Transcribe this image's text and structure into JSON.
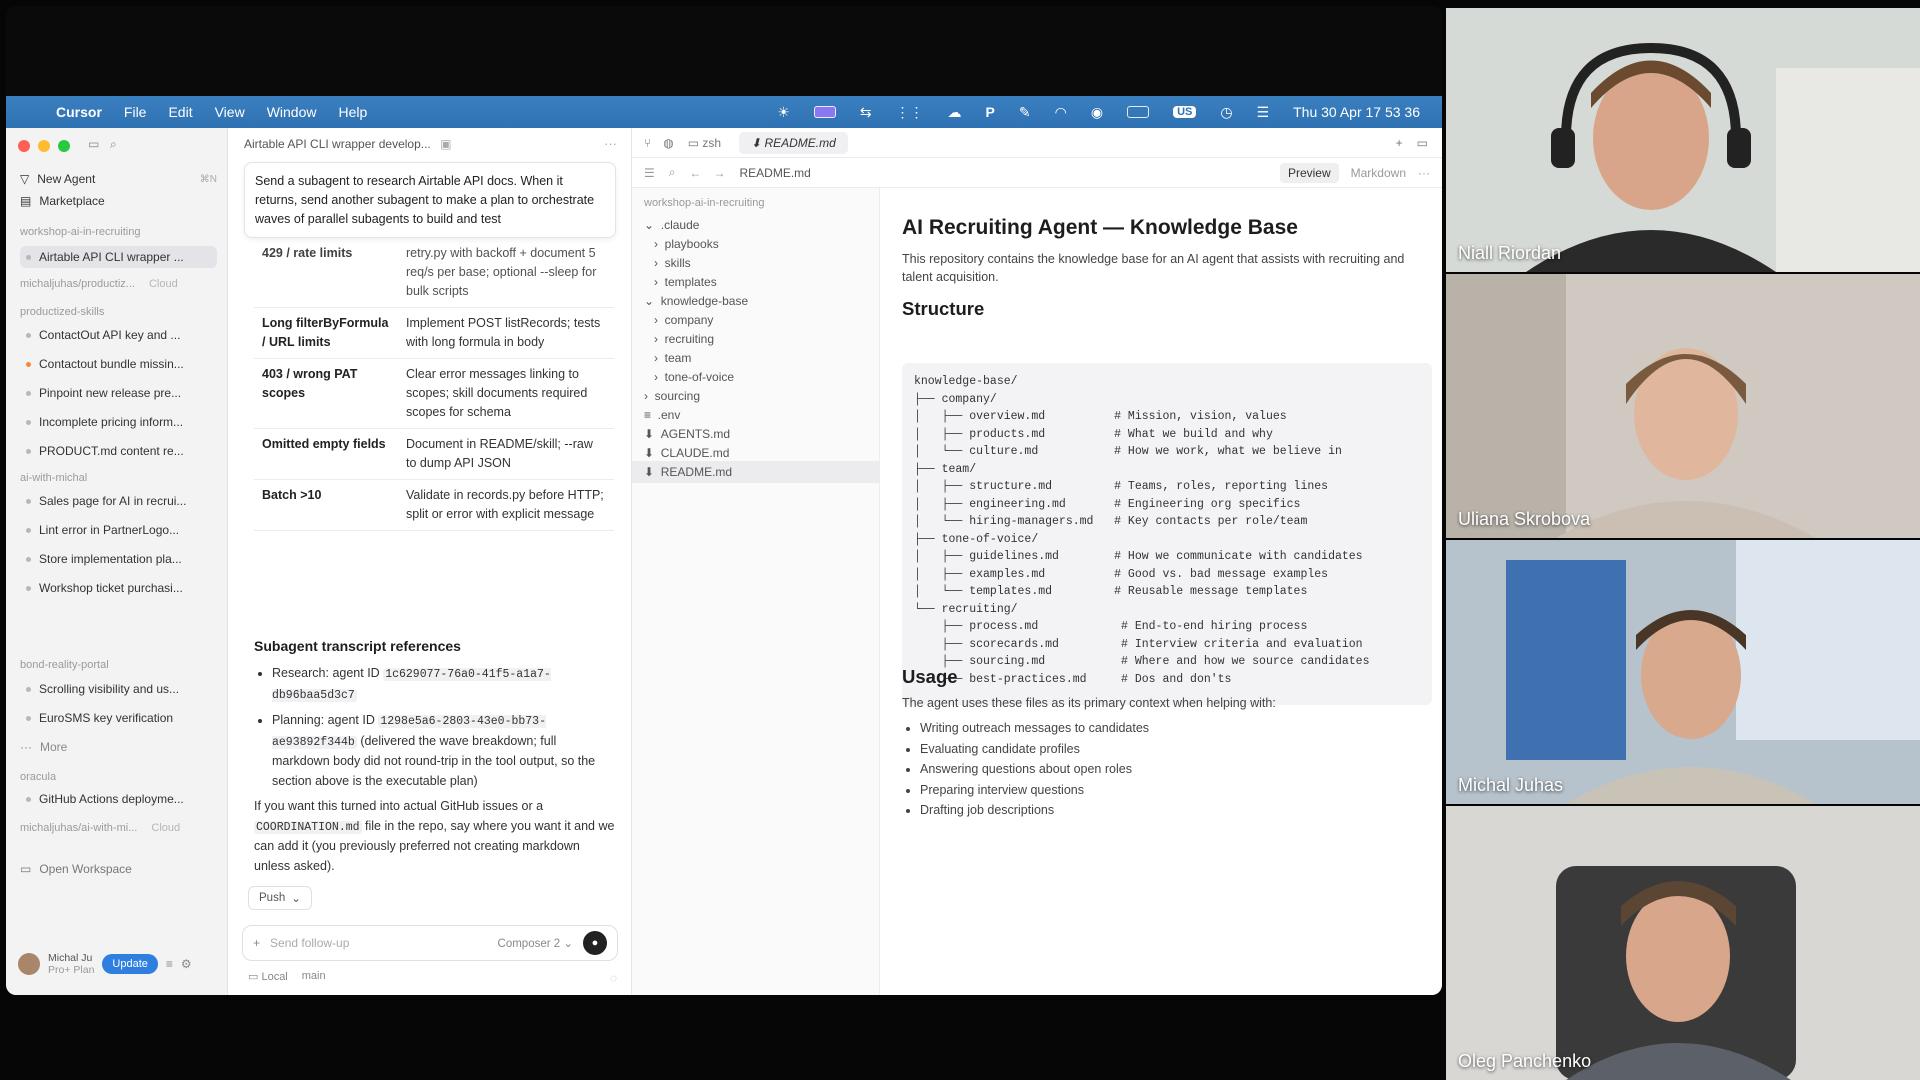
{
  "menubar": {
    "app_name": "Cursor",
    "menus": [
      "File",
      "Edit",
      "View",
      "Window",
      "Help"
    ],
    "clock": "Thu 30 Apr  17 53 36",
    "input_badge": "US"
  },
  "sidebar": {
    "new_agent": "New Agent",
    "new_agent_shortcut": "⌘N",
    "marketplace": "Marketplace",
    "groups": [
      {
        "label": "workshop-ai-in-recruiting",
        "tag": "",
        "items": [
          "Airtable API CLI wrapper ..."
        ]
      },
      {
        "label": "michaljuhas/productiz...",
        "tag": "Cloud",
        "items": []
      },
      {
        "label": "productized-skills",
        "tag": "",
        "items": [
          "ContactOut API key and ...",
          "Contactout bundle missin...",
          "Pinpoint new release pre...",
          "Incomplete pricing inform...",
          "PRODUCT.md content re..."
        ]
      },
      {
        "label": "ai-with-michal",
        "tag": "",
        "items": [
          "Sales page for AI in recrui...",
          "Lint error in PartnerLogo...",
          "Store implementation pla...",
          "Workshop ticket purchasi..."
        ]
      },
      {
        "label": "bond-reality-portal",
        "tag": "",
        "items": [
          "Scrolling visibility and us...",
          "EuroSMS key verification"
        ]
      },
      {
        "label": "oracula",
        "tag": "",
        "items": [
          "GitHub Actions deployme..."
        ]
      },
      {
        "label": "michaljuhas/ai-with-mi...",
        "tag": "Cloud",
        "items": []
      }
    ],
    "more": "More",
    "open_workspace": "Open Workspace",
    "user_name": "Michal Ju",
    "user_plan": "Pro+ Plan",
    "update_button": "Update"
  },
  "chat": {
    "title": "Airtable API CLI wrapper develop...",
    "prompt": "Send a subagent to research Airtable API docs. When it returns, send another subagent to make a plan to orchestrate waves of parallel subagents to build and test",
    "table_top_fragment": {
      "left": "429 / rate limits",
      "right": "retry.py with backoff + document 5 req/s per base; optional --sleep for bulk scripts"
    },
    "table": [
      {
        "left": "Long filterByFormula / URL limits",
        "right": "Implement POST listRecords; tests with long formula in body"
      },
      {
        "left": "403 / wrong PAT scopes",
        "right": "Clear error messages linking to scopes; skill documents required scopes for schema"
      },
      {
        "left": "Omitted empty fields",
        "right": "Document in README/skill; --raw to dump API JSON"
      },
      {
        "left": "Batch >10",
        "right": "Validate in records.py before HTTP; split or error with explicit message"
      }
    ],
    "refs_heading": "Subagent transcript references",
    "ref1_label": "Research: agent ID",
    "ref1_id": "1c629077-76a0-41f5-a1a7-db96baa5d3c7",
    "ref2_label": "Planning: agent ID",
    "ref2_id": "1298e5a6-2803-43e0-bb73-ae93892f344b",
    "ref2_note": "(delivered the wave breakdown; full markdown body did not round-trip in the tool output, so the section above is the executable plan)",
    "closing_pre": "If you want this turned into actual GitHub issues or a",
    "closing_code": "COORDINATION.md",
    "closing_post": "file in the repo, say where you want it and we can add it (you previously preferred not creating markdown unless asked).",
    "push_label": "Push",
    "followup_placeholder": "Send follow-up",
    "model_label": "Composer 2",
    "footer_local": "Local",
    "footer_branch": "main"
  },
  "editor": {
    "tab_terminal": "zsh",
    "tab_active": "README.md",
    "breadcrumb": "README.md",
    "preview_tab": "Preview",
    "markdown_tab": "Markdown"
  },
  "tree": {
    "root": "workshop-ai-in-recruiting",
    "items": [
      ".claude",
      "playbooks",
      "skills",
      "templates",
      "knowledge-base",
      "company",
      "recruiting",
      "team",
      "tone-of-voice",
      "sourcing",
      ".env",
      "AGENTS.md",
      "CLAUDE.md",
      "README.md"
    ]
  },
  "doc": {
    "title": "AI Recruiting Agent — Knowledge Base",
    "intro": "This repository contains the knowledge base for an AI agent that assists with recruiting and talent acquisition.",
    "structure_heading": "Structure",
    "code": "knowledge-base/\n├── company/\n│   ├── overview.md          # Mission, vision, values\n│   ├── products.md          # What we build and why\n│   └── culture.md           # How we work, what we believe in\n├── team/\n│   ├── structure.md         # Teams, roles, reporting lines\n│   ├── engineering.md       # Engineering org specifics\n│   └── hiring-managers.md   # Key contacts per role/team\n├── tone-of-voice/\n│   ├── guidelines.md        # How we communicate with candidates\n│   ├── examples.md          # Good vs. bad message examples\n│   └── templates.md         # Reusable message templates\n└── recruiting/\n    ├── process.md            # End-to-end hiring process\n    ├── scorecards.md         # Interview criteria and evaluation\n    ├── sourcing.md           # Where and how we source candidates\n    └── best-practices.md     # Dos and don'ts",
    "usage_heading": "Usage",
    "usage_intro": "The agent uses these files as its primary context when helping with:",
    "usage_items": [
      "Writing outreach messages to candidates",
      "Evaluating candidate profiles",
      "Answering questions about open roles",
      "Preparing interview questions",
      "Drafting job descriptions"
    ]
  },
  "participants": [
    {
      "name": "Niall Riordan",
      "bg": "#cfd3d0"
    },
    {
      "name": "Uliana Skrobova",
      "bg": "#c9c4bd"
    },
    {
      "name": "Michal Juhas",
      "bg": "#b9c3cc"
    },
    {
      "name": "Oleg Panchenko",
      "bg": "#d4d2cf"
    }
  ]
}
